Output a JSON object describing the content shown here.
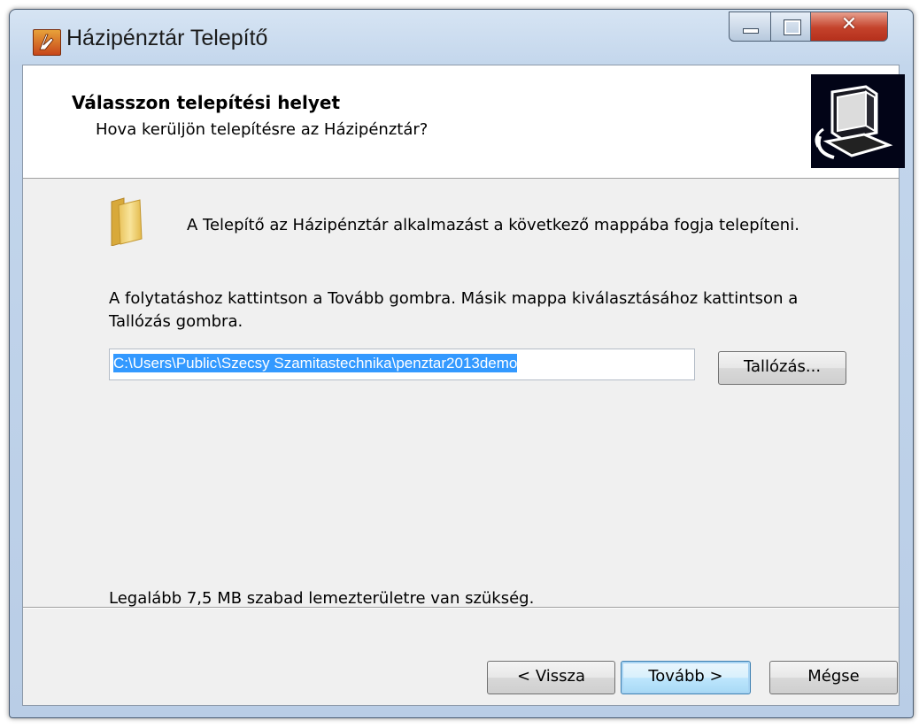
{
  "window": {
    "title": "Házipénztár Telepítő"
  },
  "header": {
    "title": "Válasszon telepítési helyet",
    "subtitle": "Hova kerüljön telepítésre az Házipénztár?"
  },
  "content": {
    "info_text": "A Telepítő az Házipénztár alkalmazást a következő mappába fogja telepíteni.",
    "instruction_line1": "A folytatáshoz kattintson a Tovább gombra. Másik mappa kiválasztásához kattintson a",
    "instruction_line2": "Tallózás gombra.",
    "path_value": "C:\\Users\\Public\\Szecsy Szamitastechnika\\penztar2013demo",
    "browse_label": "Tallózás...",
    "disk_space_text": "Legalább 7,5 MB szabad lemezterületre van szükség."
  },
  "footer": {
    "back_label": "< Vissza",
    "next_label": "Tovább >",
    "cancel_label": "Mégse"
  },
  "colors": {
    "selection": "#3399ff",
    "header_image_bg": "#020417",
    "close_button": "#c4422b"
  }
}
